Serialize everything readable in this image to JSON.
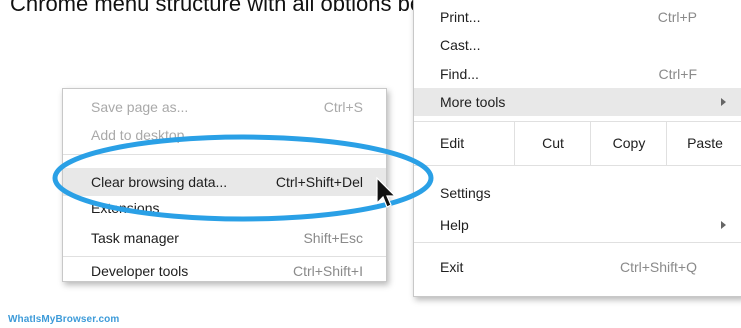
{
  "background_text": "Chrome menu structure with all options being",
  "main_menu": {
    "items": [
      {
        "label": "Print...",
        "shortcut": "Ctrl+P"
      },
      {
        "label": "Cast...",
        "shortcut": ""
      },
      {
        "label": "Find...",
        "shortcut": "Ctrl+F"
      },
      {
        "label": "More tools",
        "shortcut": ""
      }
    ],
    "edit_row": {
      "label": "Edit",
      "cut": "Cut",
      "copy": "Copy",
      "paste": "Paste"
    },
    "items_after": [
      {
        "label": "Settings",
        "shortcut": ""
      },
      {
        "label": "Help",
        "shortcut": ""
      },
      {
        "label": "Exit",
        "shortcut": "Ctrl+Shift+Q"
      }
    ]
  },
  "sub_menu": {
    "items": [
      {
        "label": "Save page as...",
        "shortcut": "Ctrl+S",
        "disabled": true
      },
      {
        "label": "Add to desktop...",
        "shortcut": "",
        "disabled": true
      },
      {
        "label": "Clear browsing data...",
        "shortcut": "Ctrl+Shift+Del",
        "disabled": false,
        "selected": true
      },
      {
        "label": "Extensions",
        "shortcut": "",
        "disabled": false
      },
      {
        "label": "Task manager",
        "shortcut": "Shift+Esc",
        "disabled": false
      },
      {
        "label": "Developer tools",
        "shortcut": "Ctrl+Shift+I",
        "disabled": false
      }
    ]
  },
  "annotation_color": "#2aa0e6",
  "watermark": "WhatIsMyBrowser.com"
}
